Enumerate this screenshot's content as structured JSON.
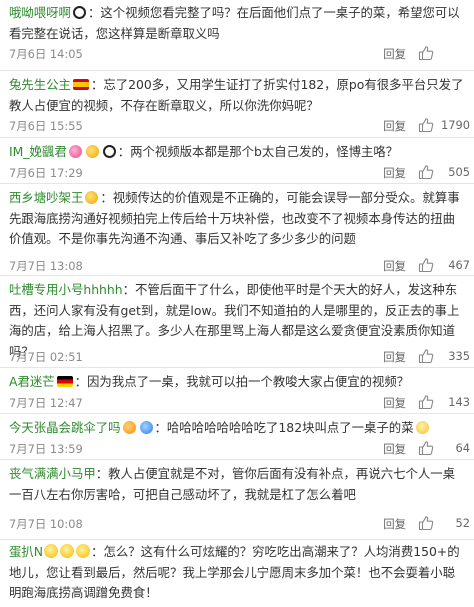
{
  "comments": [
    {
      "username": "哦呦喂呀啊",
      "badge": "panda",
      "text": "：这个视频您看完整了吗？在后面他们点了一桌子的菜，希望您可以看完整在说话，您这样算是断章取义吗",
      "time": "7月6日 14:05",
      "reply_label": "回复",
      "likes": ""
    },
    {
      "username": "兔先生公主",
      "badge": "spain-flag",
      "text": "：忘了200多，又用学生证打了折实付182，原po有很多平台只发了教人占便宜的视频，不存在断章取义，所以你洗你妈呢？",
      "time": "7月6日 15:55",
      "reply_label": "回复",
      "likes": "1790"
    },
    {
      "username": "IM_娩颻君",
      "badge": "pink-gold-panda",
      "text": "：两个视频版本都是那个b太自己发的，怪博主咯？",
      "time": "7月6日 17:29",
      "reply_label": "回复",
      "likes": "505"
    },
    {
      "username": "西乡塘吵架王",
      "badge": "gold",
      "text": "：视频传达的价值观是不正确的，可能会误导一部分受众。就算事先跟海底捞沟通好视频拍完上传后给十万块补偿，也改变不了视频本身传达的扭曲价值观。不是你事先沟通不沟通、事后又补吃了多少多少的问题",
      "time": "7月7日 13:08",
      "reply_label": "回复",
      "likes": "467"
    },
    {
      "username": "吐槽专用小号hhhhh",
      "badge": "",
      "text": "：不管后面干了什么，即使他平时是个天大的好人，发这种东西，还问人家有没有get到，就是low。我们不知道拍的人是哪里的，反正去的事上海的店，给上海人招黑了。多少人在那里骂上海人都是这么爱贪便宜没素质你知道吗？",
      "time": "7月7日 02:51",
      "reply_label": "回复",
      "likes": "335"
    },
    {
      "username": "A君迷芒",
      "badge": "germany-flag",
      "text": "：因为我点了一桌，我就可以拍一个教唆大家占便宜的视频？",
      "time": "7月7日 12:47",
      "reply_label": "回复",
      "likes": "143"
    },
    {
      "username": "今天张晶会跳伞了吗",
      "badge": "orange-blue",
      "text": "：哈哈哈哈哈哈哈吃了182块叫点了一桌子的菜",
      "time": "7月7日 13:59",
      "reply_label": "回复",
      "likes": "64"
    },
    {
      "username": "丧气满满小马甲",
      "badge": "",
      "text": "：教人占便宜就是不对，管你后面有没有补点，再说六七个人一桌一百八左右你厉害哈，可把自己感动坏了，我就是杠了怎么着吧",
      "time": "7月7日 10:08",
      "reply_label": "回复",
      "likes": "52"
    },
    {
      "username": "蛋扒N",
      "badge": "",
      "text": "：怎么？这有什么可炫耀的？穷吃吃出高潮来了？人均消费150+的地儿，您让看到最后，然后呢？我上学那会儿宁愿周末多加个菜！也不会耍着小聪明跑海底捞高调蹭免费食！",
      "time": "",
      "reply_label": "",
      "likes": ""
    }
  ]
}
